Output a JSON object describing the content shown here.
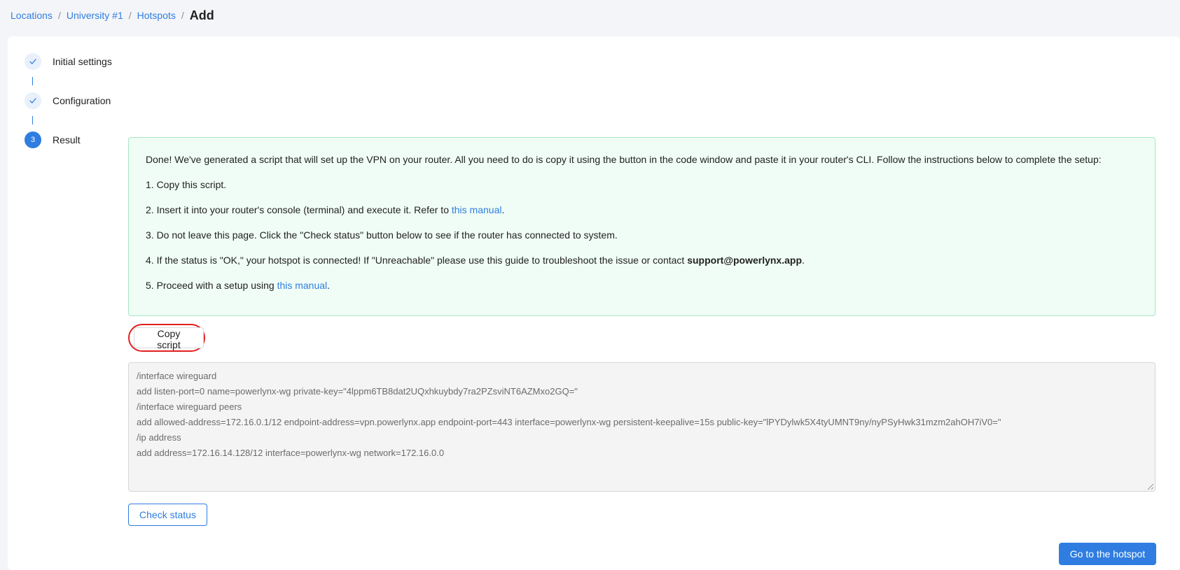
{
  "breadcrumb": {
    "items": [
      "Locations",
      "University #1",
      "Hotspots"
    ],
    "separator": "/",
    "current": "Add"
  },
  "steps": [
    {
      "label": "Initial settings",
      "status": "done",
      "icon": "check-icon"
    },
    {
      "label": "Configuration",
      "status": "done",
      "icon": "check-icon"
    },
    {
      "label": "Result",
      "status": "active",
      "number": "3"
    }
  ],
  "info": {
    "intro": "Done! We've generated a script that will set up the VPN on your router. All you need to do is copy it using the button in the code window and paste it in your router's CLI. Follow the instructions below to complete the setup:",
    "step1": "1. Copy this script.",
    "step2_before": "2. Insert it into your router's console (terminal) and execute it. Refer to ",
    "step2_link": "this manual",
    "step2_after": ".",
    "step3": "3. Do not leave this page. Click the \"Check status\" button below to see if the router has connected to system.",
    "step4_before": "4. If the status is \"OK,\" your hotspot is connected! If \"Unreachable\" please use this guide to troubleshoot the issue or contact ",
    "step4_email": "support@powerlynx.app",
    "step4_after": ".",
    "step5_before": "5. Proceed with a setup using ",
    "step5_link": "this manual",
    "step5_after": "."
  },
  "actions": {
    "copy_label": "Copy script",
    "check_label": "Check status",
    "goto_label": "Go to the hotspot"
  },
  "script_lines": [
    "/interface wireguard",
    "add listen-port=0 name=powerlynx-wg private-key=\"4lppm6TB8dat2UQxhkuybdy7ra2PZsviNT6AZMxo2GQ=\"",
    "/interface wireguard peers",
    "add allowed-address=172.16.0.1/12 endpoint-address=vpn.powerlynx.app endpoint-port=443 interface=powerlynx-wg persistent-keepalive=15s public-key=\"lPYDylwk5X4tyUMNT9ny/nyPSyHwk31mzm2ahOH7iV0=\"",
    "/ip address",
    "add address=172.16.14.128/12 interface=powerlynx-wg network=172.16.0.0"
  ],
  "colors": {
    "accent": "#2f7de1",
    "success_bg": "#f0fdf6",
    "success_border": "#a8e6c4",
    "highlight_ring": "#e02020"
  }
}
